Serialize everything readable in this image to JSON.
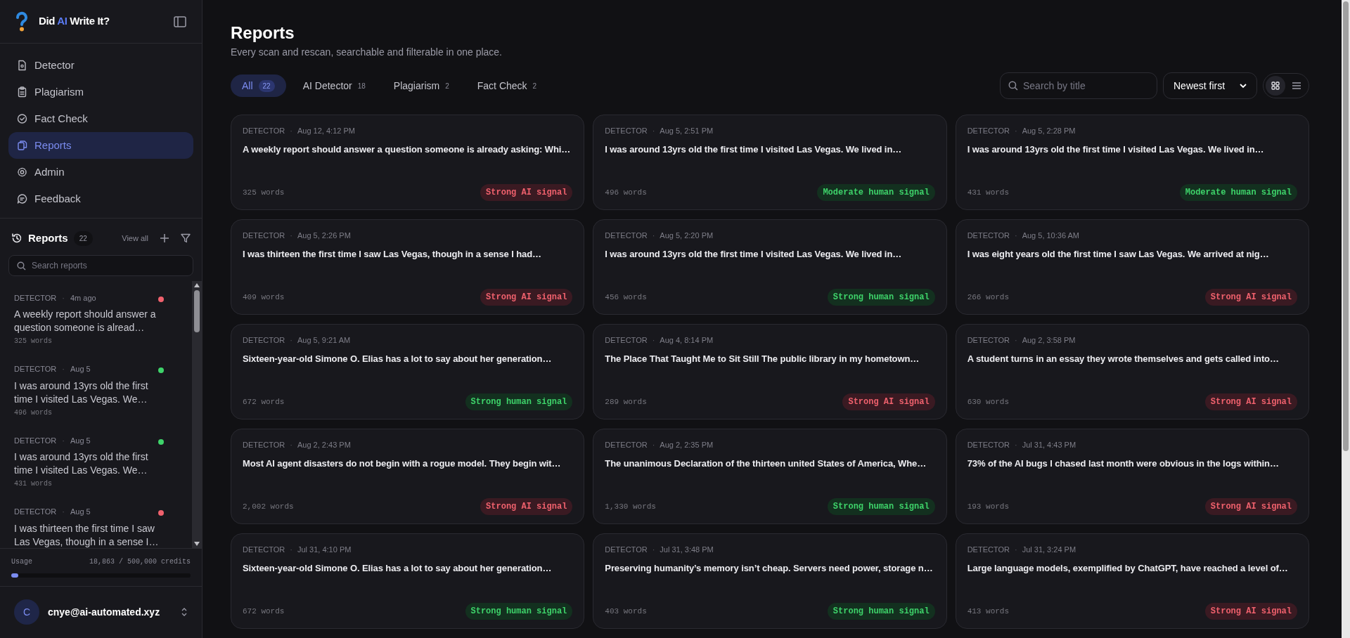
{
  "brand": {
    "prefix": "Did ",
    "highlight": "AI",
    "suffix": " Write It?"
  },
  "nav": [
    {
      "label": "Detector",
      "selected": false
    },
    {
      "label": "Plagiarism",
      "selected": false
    },
    {
      "label": "Fact Check",
      "selected": false
    },
    {
      "label": "Reports",
      "selected": true
    },
    {
      "label": "Admin",
      "selected": false
    },
    {
      "label": "Feedback",
      "selected": false
    }
  ],
  "recent": {
    "title": "Reports",
    "count": "22",
    "view_all": "View all",
    "search_placeholder": "Search reports",
    "items": [
      {
        "type": "DETECTOR",
        "sep": "·",
        "when": "4m ago",
        "text": "A weekly report should answer a question someone is alread…",
        "words": "325 words",
        "color": "#f0616d"
      },
      {
        "type": "DETECTOR",
        "sep": "·",
        "when": "Aug 5",
        "text": "I was around 13yrs old the first time I visited Las Vegas. We…",
        "words": "496 words",
        "color": "#3ed36a"
      },
      {
        "type": "DETECTOR",
        "sep": "·",
        "when": "Aug 5",
        "text": "I was around 13yrs old the first time I visited Las Vegas. We…",
        "words": "431 words",
        "color": "#3ed36a"
      },
      {
        "type": "DETECTOR",
        "sep": "·",
        "when": "Aug 5",
        "text": "I was thirteen the first time I saw Las Vegas, though in a sense I…",
        "color": "#f0616d"
      }
    ]
  },
  "usage": {
    "label": "Usage",
    "reading": "18,863 / 500,000 credits",
    "level": 0.04
  },
  "user": {
    "initial": "C",
    "email": "cnye@ai-automated.xyz"
  },
  "page": {
    "title": "Reports",
    "subtitle": "Every scan and rescan, searchable and filterable in one place."
  },
  "tabs": [
    {
      "label": "All",
      "count": "22",
      "selected": true
    },
    {
      "label": "AI Detector",
      "count": "18",
      "selected": false
    },
    {
      "label": "Plagiarism",
      "count": "2",
      "selected": false
    },
    {
      "label": "Fact Check",
      "count": "2",
      "selected": false
    }
  ],
  "search": {
    "placeholder": "Search by title"
  },
  "sort": {
    "value": "Newest first"
  },
  "view": {
    "grid_selected": true
  },
  "cards": [
    {
      "type": "DETECTOR",
      "sep": "·",
      "when": "Aug 12, 4:12 PM",
      "text": "A weekly report should answer a question someone is already asking: Whi…",
      "words": "325 words",
      "verdict": "Strong AI signal",
      "kind": "ai"
    },
    {
      "type": "DETECTOR",
      "sep": "·",
      "when": "Aug 5, 2:51 PM",
      "text": "I was around 13yrs old the first time I visited Las Vegas. We lived in…",
      "words": "496 words",
      "verdict": "Moderate human signal",
      "kind": "human"
    },
    {
      "type": "DETECTOR",
      "sep": "·",
      "when": "Aug 5, 2:28 PM",
      "text": "I was around 13yrs old the first time I visited Las Vegas. We lived in…",
      "words": "431 words",
      "verdict": "Moderate human signal",
      "kind": "human"
    },
    {
      "type": "DETECTOR",
      "sep": "·",
      "when": "Aug 5, 2:26 PM",
      "text": "I was thirteen the first time I saw Las Vegas, though in a sense I had…",
      "words": "409 words",
      "verdict": "Strong AI signal",
      "kind": "ai"
    },
    {
      "type": "DETECTOR",
      "sep": "·",
      "when": "Aug 5, 2:20 PM",
      "text": "I was around 13yrs old the first time I visited Las Vegas. We lived in…",
      "words": "456 words",
      "verdict": "Strong human signal",
      "kind": "human"
    },
    {
      "type": "DETECTOR",
      "sep": "·",
      "when": "Aug 5, 10:36 AM",
      "text": "I was eight years old the first time I saw Las Vegas. We arrived at nig…",
      "words": "266 words",
      "verdict": "Strong AI signal",
      "kind": "ai"
    },
    {
      "type": "DETECTOR",
      "sep": "·",
      "when": "Aug 5, 9:21 AM",
      "text": "Sixteen-year-old Simone O. Elias has a lot to say about her generation…",
      "words": "672 words",
      "verdict": "Strong human signal",
      "kind": "human"
    },
    {
      "type": "DETECTOR",
      "sep": "·",
      "when": "Aug 4, 8:14 PM",
      "text": "The Place That Taught Me to Sit Still The public library in my hometown…",
      "words": "289 words",
      "verdict": "Strong AI signal",
      "kind": "ai"
    },
    {
      "type": "DETECTOR",
      "sep": "·",
      "when": "Aug 2, 3:58 PM",
      "text": "A student turns in an essay they wrote themselves and gets called into…",
      "words": "630 words",
      "verdict": "Strong AI signal",
      "kind": "ai"
    },
    {
      "type": "DETECTOR",
      "sep": "·",
      "when": "Aug 2, 2:43 PM",
      "text": "Most AI agent disasters do not begin with a rogue model. They begin wit…",
      "words": "2,002 words",
      "verdict": "Strong AI signal",
      "kind": "ai"
    },
    {
      "type": "DETECTOR",
      "sep": "·",
      "when": "Aug 2, 2:35 PM",
      "text": "The unanimous Declaration of the thirteen united States of America, Whe…",
      "words": "1,330 words",
      "verdict": "Strong human signal",
      "kind": "human"
    },
    {
      "type": "DETECTOR",
      "sep": "·",
      "when": "Jul 31, 4:43 PM",
      "text": "73% of the AI bugs I chased last month were obvious in the logs within…",
      "words": "193 words",
      "verdict": "Strong AI signal",
      "kind": "ai"
    },
    {
      "type": "DETECTOR",
      "sep": "·",
      "when": "Jul 31, 4:10 PM",
      "text": "Sixteen-year-old Simone O. Elias has a lot to say about her generation…",
      "words": "672 words",
      "verdict": "Strong human signal",
      "kind": "human"
    },
    {
      "type": "DETECTOR",
      "sep": "·",
      "when": "Jul 31, 3:48 PM",
      "text": "Preserving humanity’s memory isn’t cheap. Servers need power, storage n…",
      "words": "403 words",
      "verdict": "Strong human signal",
      "kind": "human"
    },
    {
      "type": "DETECTOR",
      "sep": "·",
      "when": "Jul 31, 3:24 PM",
      "text": "Large language models, exemplified by ChatGPT, have reached a level of…",
      "words": "413 words",
      "verdict": "Strong AI signal",
      "kind": "ai"
    }
  ]
}
